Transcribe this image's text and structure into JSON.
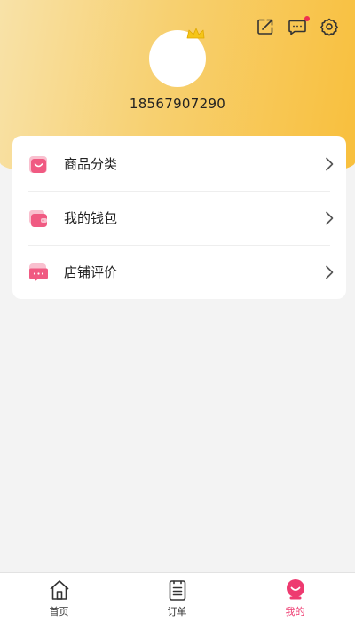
{
  "profile": {
    "phone": "18567907290"
  },
  "header_icons": [
    "share-icon",
    "message-icon",
    "settings-icon"
  ],
  "menu": {
    "items": [
      {
        "label": "商品分类",
        "icon": "category-bag-icon"
      },
      {
        "label": "我的钱包",
        "icon": "wallet-icon"
      },
      {
        "label": "店铺评价",
        "icon": "review-chat-icon"
      }
    ]
  },
  "tabbar": {
    "tabs": [
      {
        "label": "首页",
        "icon": "home-icon",
        "active": false
      },
      {
        "label": "订单",
        "icon": "order-list-icon",
        "active": false
      },
      {
        "label": "我的",
        "icon": "profile-face-icon",
        "active": true
      }
    ]
  },
  "colors": {
    "header_gradient_start": "#f8e2a8",
    "header_gradient_end": "#f8bf3c",
    "accent_pink": "#ee3a70",
    "notification_dot": "#ef2f4f",
    "background": "#f3f3f3"
  }
}
